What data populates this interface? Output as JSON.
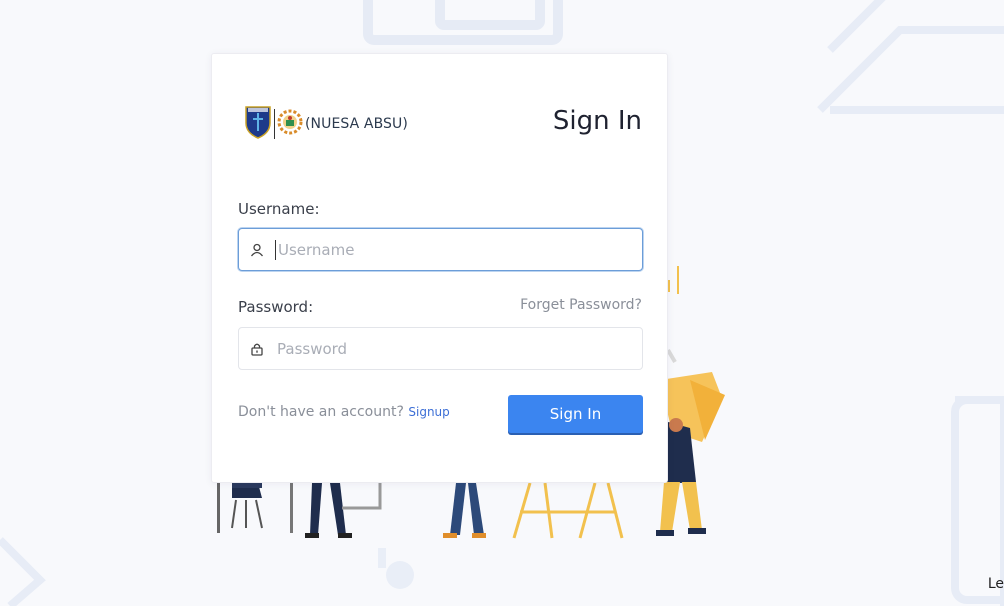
{
  "brand": {
    "logo_text": "(NUESA ABSU)"
  },
  "form": {
    "title": "Sign In",
    "username_label": "Username:",
    "username_placeholder": "Username",
    "username_value": "",
    "password_label": "Password:",
    "password_placeholder": "Password",
    "password_value": "",
    "forget_password": "Forget Password?",
    "no_account_text": "Don't have an account?",
    "signup_link": "Signup",
    "submit_label": "Sign In"
  },
  "corner_text": "Le",
  "colors": {
    "accent": "#3b85f0",
    "link": "#3d6fd6",
    "illustration_yellow": "#f2c14e",
    "illustration_navy": "#1f2d4d"
  },
  "icons": [
    "user-icon",
    "lock-icon",
    "university-crest-icon",
    "nuesa-gear-logo-icon"
  ]
}
